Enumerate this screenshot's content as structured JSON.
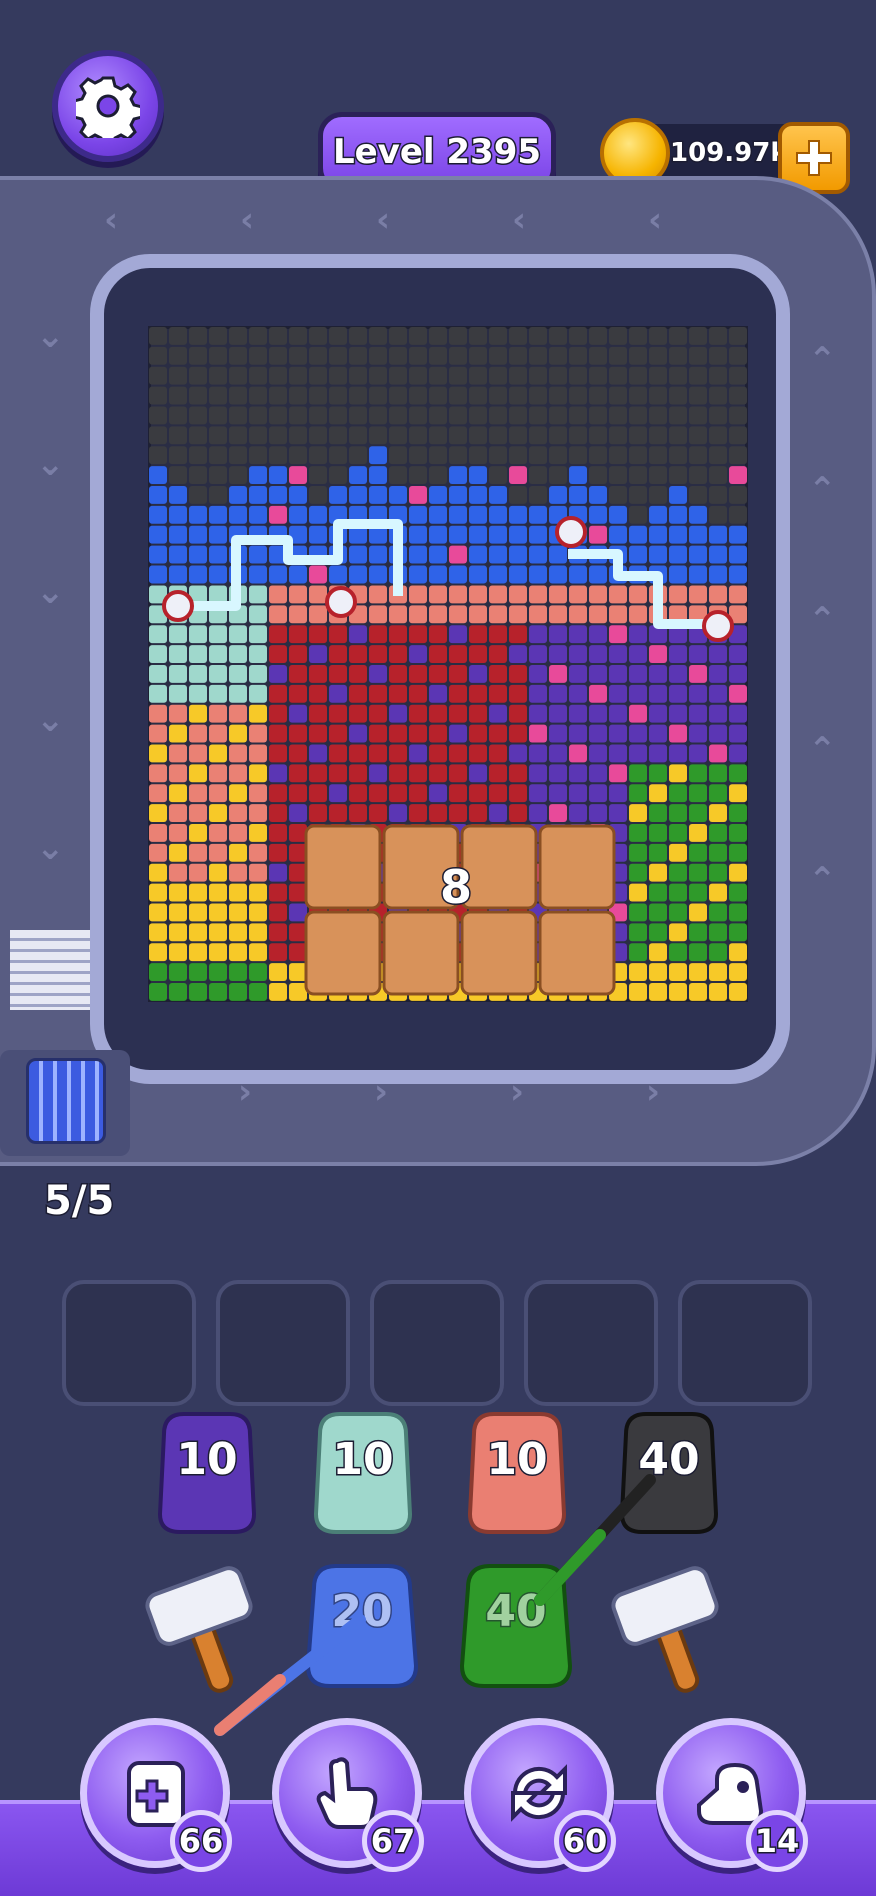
{
  "header": {
    "settings_icon": "gear-icon",
    "level_label": "Level 2395",
    "coins": "109.97k",
    "coin_icon": "coin-icon",
    "add_coins_icon": "plus-icon"
  },
  "board": {
    "crate_counter": "8",
    "lane_counter": "5/5"
  },
  "slots": {
    "count": 5
  },
  "shooters": {
    "row1": [
      {
        "label": "10",
        "color": "#5b36b4"
      },
      {
        "label": "10",
        "color": "#9fd8cc"
      },
      {
        "label": "10",
        "color": "#ea7f72"
      },
      {
        "label": "40",
        "color": "#3a3a3e"
      }
    ],
    "row2": [
      {
        "label": "20",
        "color": "#4c74e6"
      },
      {
        "label": "40",
        "color": "#2f9a2a"
      }
    ]
  },
  "powerups": [
    {
      "icon": "add-slot-icon",
      "count": "66"
    },
    {
      "icon": "pointer-hand-icon",
      "count": "67"
    },
    {
      "icon": "shuffle-icon",
      "count": "60"
    },
    {
      "icon": "shooter-icon",
      "count": "14"
    }
  ],
  "colors": {
    "blue": "#2f63e8",
    "black": "#3a3b40",
    "pink": "#e84a9a",
    "salmon": "#ea8174",
    "red": "#b7222b",
    "purple": "#5b36b4",
    "teal": "#9fd8cc",
    "yellow": "#f7c928",
    "green": "#2f9a2a",
    "crate": "#d8925a"
  }
}
